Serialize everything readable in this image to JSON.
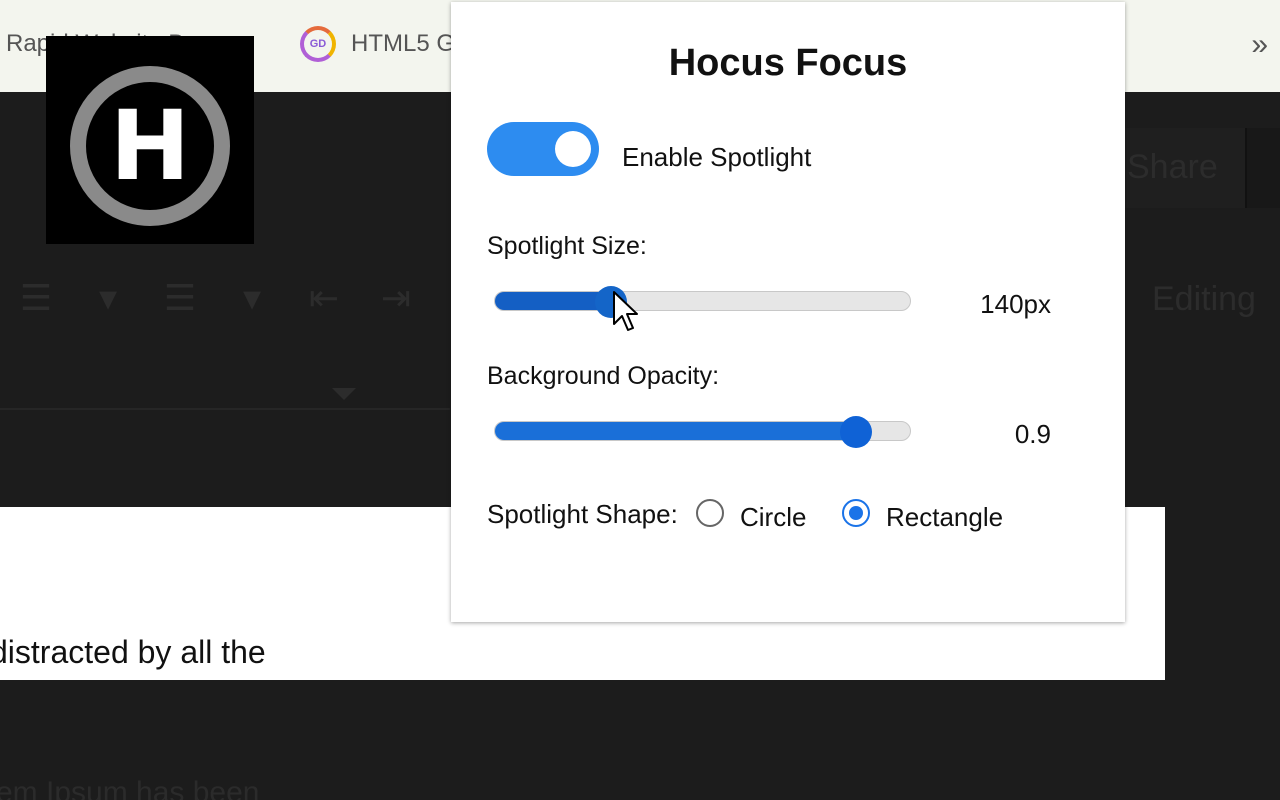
{
  "bookmarks": [
    {
      "label": "Rapid Website Be..."
    },
    {
      "label": "HTML5 G",
      "icon": "gd-logo-icon"
    }
  ],
  "bookmarks_overflow": "»",
  "logo": {
    "letter": "H"
  },
  "editor": {
    "share_label": "Share",
    "editing_label": "Editing",
    "doc_line_1": "distracted by all the",
    "doc_line_2": "em Ipsum has been"
  },
  "popup": {
    "title": "Hocus Focus",
    "enable_spotlight": {
      "label": "Enable Spotlight",
      "enabled": true
    },
    "spotlight_size": {
      "label": "Spotlight Size:",
      "value_text": "140px",
      "fraction": 0.28
    },
    "background_opacity": {
      "label": "Background Opacity:",
      "value_text": "0.9",
      "fraction": 0.87
    },
    "spotlight_shape": {
      "label": "Spotlight Shape:",
      "options": [
        "Circle",
        "Rectangle"
      ],
      "selected": "Rectangle"
    }
  },
  "colors": {
    "accent": "#2d8cf0",
    "slider_fill": "#1a6fd8"
  }
}
